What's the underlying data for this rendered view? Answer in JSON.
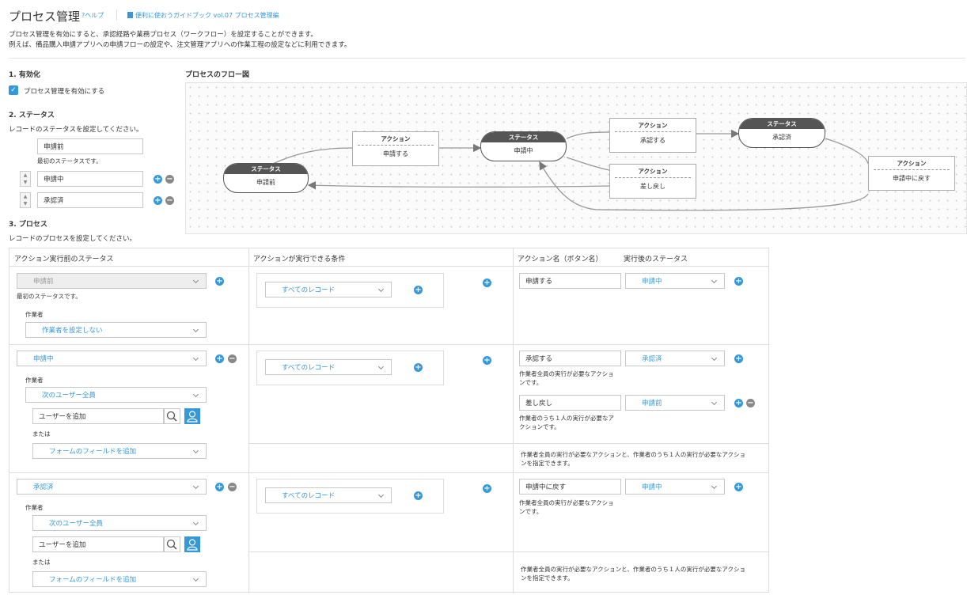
{
  "header": {
    "title": "プロセス管理",
    "help": "ヘルプ",
    "guide": "便利に使おうガイドブック vol.07 プロセス管理編",
    "desc1": "プロセス管理を有効にすると、承認経路や業務プロセス（ワークフロー）を設定することができます。",
    "desc2": "例えば、備品購入申請アプリへの申請フローの設定や、注文管理アプリへの作業工程の設定などに利用できます。"
  },
  "enable": {
    "heading": "1. 有効化",
    "checkbox_label": "プロセス管理を有効にする",
    "checked": true
  },
  "status": {
    "heading": "2. ステータス",
    "desc": "レコードのステータスを設定してください。",
    "first": "申請前",
    "first_note": "最初のステータスです。",
    "items": [
      "申請中",
      "承認済"
    ]
  },
  "process": {
    "heading": "3. プロセス",
    "desc": "レコードのプロセスを設定してください。"
  },
  "flow": {
    "title": "プロセスのフロー図",
    "status_label": "ステータス",
    "action_label": "アクション",
    "statuses": [
      "申請前",
      "申請中",
      "承認済"
    ],
    "actions": [
      "申請する",
      "承認する",
      "差し戻し",
      "申請中に戻す"
    ]
  },
  "table": {
    "headers": {
      "before": "アクション実行前のステータス",
      "condition": "アクションが実行できる条件",
      "action_name": "アクション名（ボタン名）",
      "after": "実行後のステータス"
    },
    "assignee_label": "作業者",
    "or_label": "または",
    "all_records": "すべてのレコード",
    "user_placeholder": "ユーザーを追加",
    "field_add": "フォームのフィールドを追加",
    "first_note": "最初のステータスです。",
    "footer_note1": "作業者全員の実行が必要なアクションと、作業者のうち１人の実行が必要なアクショ",
    "footer_note2": "ンを指定できます。",
    "rows": [
      {
        "status": "申請前",
        "assignee": "作業者を設定しない",
        "actions": [
          {
            "name": "申請する",
            "next": "申請中"
          }
        ]
      },
      {
        "status": "申請中",
        "assignee": "次のユーザー全員",
        "actions": [
          {
            "name": "承認する",
            "next": "承認済",
            "note1": "作業者全員の実行が必要なアクショ",
            "note2": "ンです。"
          },
          {
            "name": "差し戻し",
            "next": "申請前",
            "note1": "作業者のうち１人の実行が必要なア",
            "note2": "クションです。"
          }
        ]
      },
      {
        "status": "承認済",
        "assignee": "次のユーザー全員",
        "actions": [
          {
            "name": "申請中に戻す",
            "next": "申請中",
            "note1": "作業者全員の実行が必要なアクショ",
            "note2": "ンです。"
          }
        ]
      }
    ]
  },
  "colors": {
    "accent": "#3498db",
    "status_header": "#555555",
    "minus": "#888888"
  },
  "icons": [
    "help-icon",
    "book-icon",
    "check-icon",
    "plus-icon",
    "minus-icon",
    "chevron-down-icon",
    "search-icon",
    "user-icon",
    "reorder-icon"
  ]
}
